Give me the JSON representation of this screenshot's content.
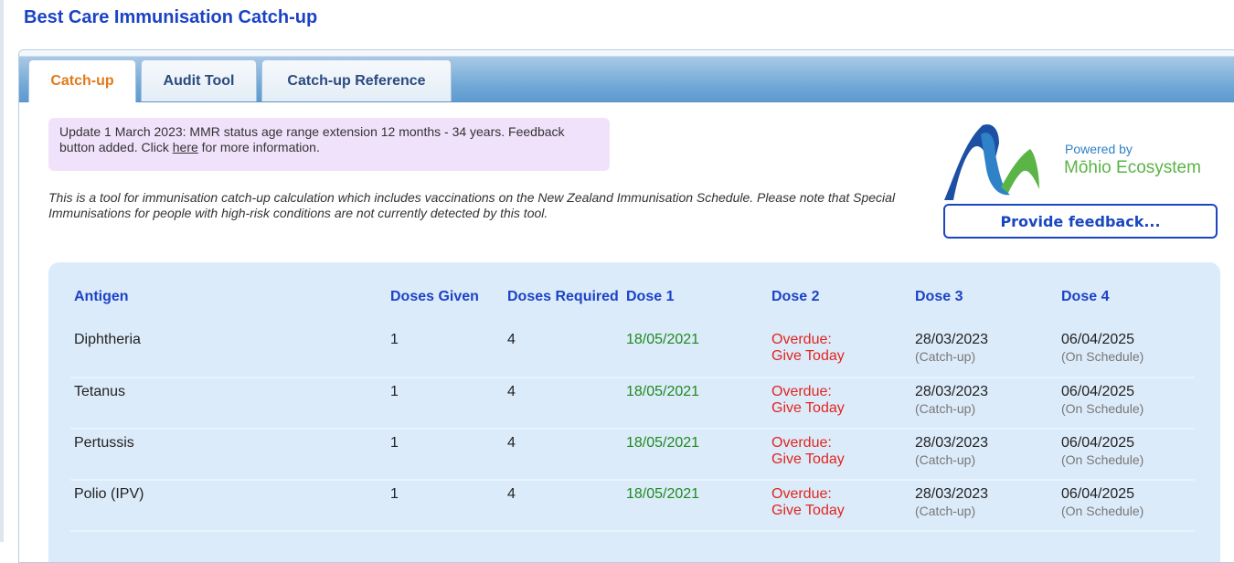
{
  "app": {
    "title": "Best Care Immunisation Catch-up"
  },
  "tabs": [
    {
      "label": "Catch-up",
      "active": true
    },
    {
      "label": "Audit Tool",
      "active": false
    },
    {
      "label": "Catch-up Reference",
      "active": false
    }
  ],
  "notice": {
    "text_before": "Update 1 March 2023: MMR status age range extension 12 months - 34 years. Feedback button added. Click ",
    "link": "here",
    "text_after": " for more information."
  },
  "intro": "This is a tool for immunisation catch-up calculation which includes vaccinations on the New Zealand Immunisation Schedule. Please note that Special Immunisations for people with high-risk conditions are not currently detected by this tool.",
  "branding": {
    "powered_by": "Powered by",
    "name": "Mōhio Ecosystem",
    "colors": {
      "blue": "#2f82c8",
      "green": "#5ab446",
      "dark_blue": "#1d4fa3"
    }
  },
  "feedback_button": "Provide feedback...",
  "table": {
    "headers": {
      "antigen": "Antigen",
      "doses_given": "Doses Given",
      "doses_required": "Doses Required",
      "dose1": "Dose 1",
      "dose2": "Dose 2",
      "dose3": "Dose 3",
      "dose4": "Dose 4"
    },
    "rows": [
      {
        "antigen": "Diphtheria",
        "given": "1",
        "required": "4",
        "dose1": "18/05/2021",
        "dose2_line1": "Overdue:",
        "dose2_line2": "Give Today",
        "dose3_date": "28/03/2023",
        "dose3_note": "(Catch-up)",
        "dose4_date": "06/04/2025",
        "dose4_note": "(On Schedule)"
      },
      {
        "antigen": "Tetanus",
        "given": "1",
        "required": "4",
        "dose1": "18/05/2021",
        "dose2_line1": "Overdue:",
        "dose2_line2": "Give Today",
        "dose3_date": "28/03/2023",
        "dose3_note": "(Catch-up)",
        "dose4_date": "06/04/2025",
        "dose4_note": "(On Schedule)"
      },
      {
        "antigen": "Pertussis",
        "given": "1",
        "required": "4",
        "dose1": "18/05/2021",
        "dose2_line1": "Overdue:",
        "dose2_line2": "Give Today",
        "dose3_date": "28/03/2023",
        "dose3_note": "(Catch-up)",
        "dose4_date": "06/04/2025",
        "dose4_note": "(On Schedule)"
      },
      {
        "antigen": "Polio (IPV)",
        "given": "1",
        "required": "4",
        "dose1": "18/05/2021",
        "dose2_line1": "Overdue:",
        "dose2_line2": "Give Today",
        "dose3_date": "28/03/2023",
        "dose3_note": "(Catch-up)",
        "dose4_date": "06/04/2025",
        "dose4_note": "(On Schedule)"
      }
    ]
  }
}
